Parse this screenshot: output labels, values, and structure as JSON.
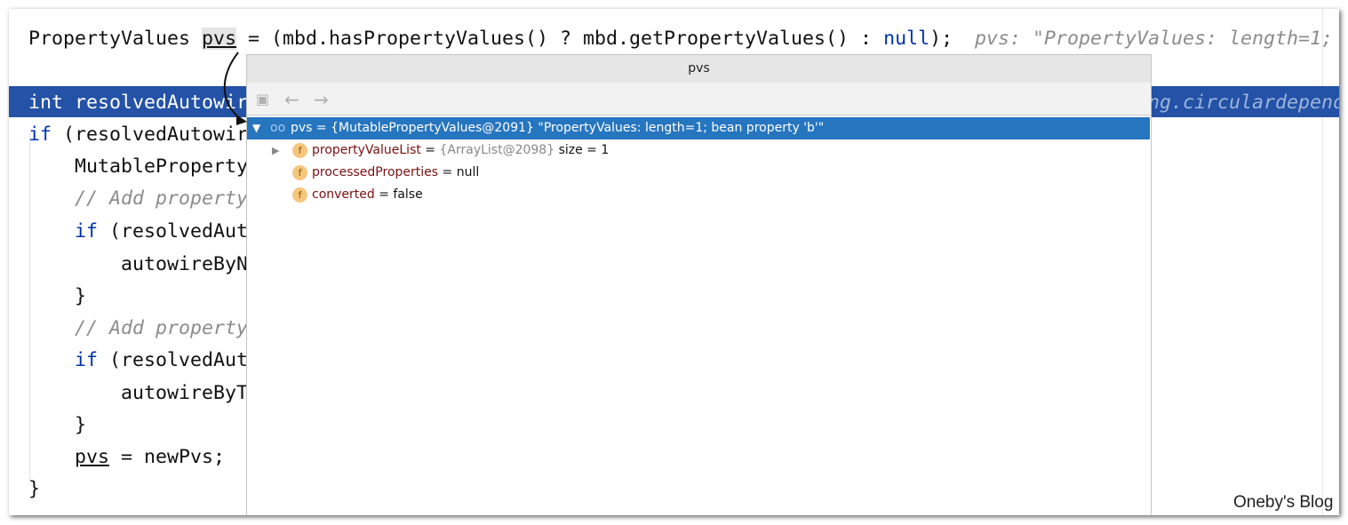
{
  "code": {
    "l1a": "PropertyValues ",
    "l1b": "pvs",
    "l1c": " = (mbd.hasPropertyValues() ? mbd.getPropertyValues() : ",
    "l1d": "null",
    "l1e": ");",
    "l1hint": "pvs: \"PropertyValues: length=1;",
    "l2a": "int",
    "l2b": " resolvedAutowir",
    "l2hint": "ng.circulardepend",
    "l3a": "if",
    "l3b": " (resolvedAutowir",
    "l4": "MutableProperty",
    "l5": "// Add property",
    "l6a": "if",
    "l6b": " (resolvedAut",
    "l7": "autowireByN",
    "l8": "}",
    "l9": "// Add property",
    "l10a": "if",
    "l10b": " (resolvedAut",
    "l11": "autowireByT",
    "l12": "}",
    "l13a": "pvs",
    "l13b": " = newPvs;",
    "l14": "}"
  },
  "popup": {
    "title": "pvs",
    "tree": [
      {
        "name": "pvs",
        "value": " = {MutablePropertyValues@2091} \"PropertyValues: length=1; bean property 'b'\""
      },
      {
        "name": "propertyValueList",
        "eq": " = ",
        "type": "{ArrayList@2098}",
        "extra": "  size = 1"
      },
      {
        "name": "processedProperties",
        "eq": " = null"
      },
      {
        "name": "converted",
        "eq": " = false"
      }
    ],
    "icons": {
      "field": "f"
    }
  },
  "watermark": "Oneby's Blog"
}
